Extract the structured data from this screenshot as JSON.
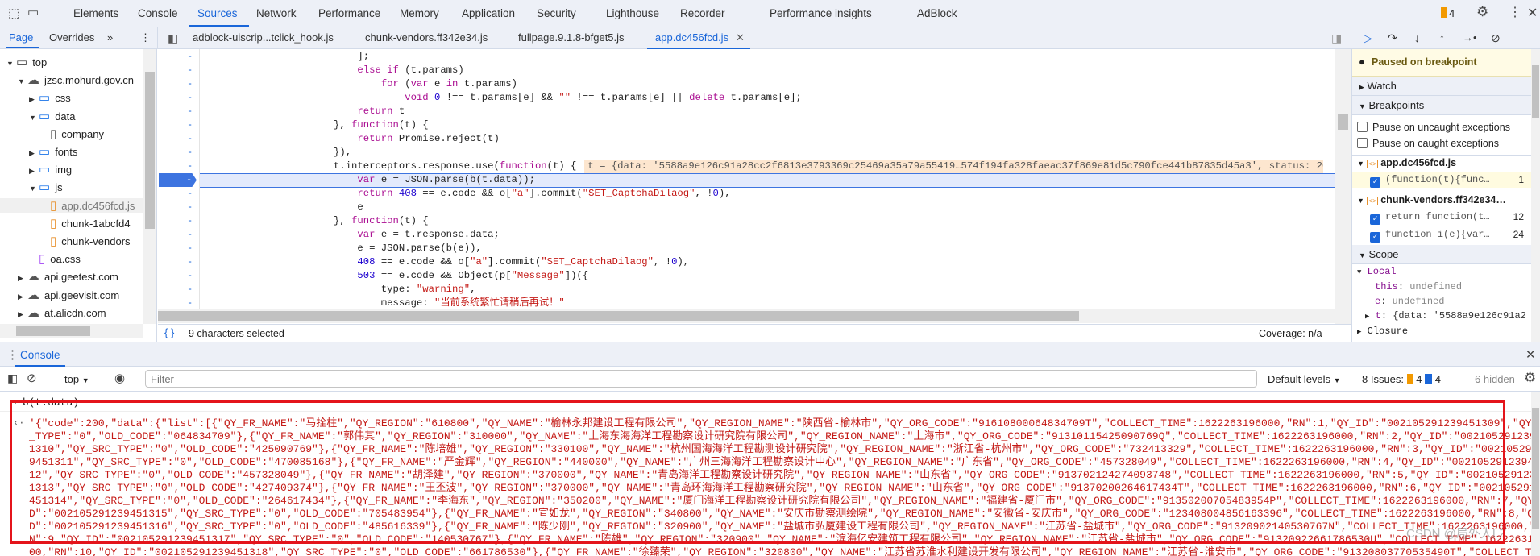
{
  "main_tabs": [
    {
      "label": "Elements"
    },
    {
      "label": "Console"
    },
    {
      "label": "Sources",
      "active": true
    },
    {
      "label": "Network"
    },
    {
      "label": "Performance"
    },
    {
      "label": "Memory"
    },
    {
      "label": "Application"
    },
    {
      "label": "Security"
    },
    {
      "label": "Lighthouse"
    },
    {
      "label": "Recorder"
    },
    {
      "label": "Performance insights"
    },
    {
      "label": "AdBlock"
    }
  ],
  "issues_badge": "4",
  "navigator_tabs": [
    "Page",
    "Overrides"
  ],
  "file_tabs": [
    "adblock-uiscrip...tclick_hook.js",
    "chunk-vendors.ff342e34.js",
    "fullpage.9.1.8-bfget5.js",
    "app.dc456fcd.js"
  ],
  "tree": [
    {
      "label": "top",
      "type": "frame",
      "depth": 0,
      "open": true
    },
    {
      "label": "jzsc.mohurd.gov.cn",
      "type": "domain",
      "depth": 1,
      "open": true
    },
    {
      "label": "css",
      "type": "folder",
      "depth": 2,
      "open": false
    },
    {
      "label": "data",
      "type": "folder",
      "depth": 2,
      "open": true
    },
    {
      "label": "company",
      "type": "file",
      "depth": 3
    },
    {
      "label": "fonts",
      "type": "folder",
      "depth": 2,
      "open": false
    },
    {
      "label": "img",
      "type": "folder",
      "depth": 2,
      "open": false
    },
    {
      "label": "js",
      "type": "folder",
      "depth": 2,
      "open": true
    },
    {
      "label": "app.dc456fcd.js",
      "type": "js",
      "depth": 3,
      "selected": true
    },
    {
      "label": "chunk-1abcfd4",
      "type": "js",
      "depth": 3
    },
    {
      "label": "chunk-vendors",
      "type": "js",
      "depth": 3
    },
    {
      "label": "oa.css",
      "type": "css",
      "depth": 2
    },
    {
      "label": "api.geetest.com",
      "type": "domain",
      "depth": 1,
      "open": false
    },
    {
      "label": "api.geevisit.com",
      "type": "domain",
      "depth": 1,
      "open": false
    },
    {
      "label": "at.alicdn.com",
      "type": "domain",
      "depth": 1,
      "open": false
    }
  ],
  "code": {
    "gutter_mark": "-",
    "exec_line_index": 10,
    "inline_value_line_index": 9,
    "inline_value": "t = {data: '5588a9e126c91a28cc2f6813e3793369c25469a35a79a55419…574f194fa328faeac37f869e81d5c790fce441b87835d45a3', status: 20",
    "lines": [
      "    ]",
      "    ];",
      "    else if (t.params)",
      "        for (var e in t.params)",
      "            void 0 !== t.params[e] && \"\" !== t.params[e] || delete t.params[e];",
      "    return t",
      "}, function(t) {",
      "    return Promise.reject(t)",
      "}),",
      "t.interceptors.response.use(function(t) {",
      "    var e = JSON.parse(b(t.data));",
      "    return 408 == e.code && o[\"a\"].commit(\"SET_CaptchaDilaog\", !0),",
      "    e",
      "}, function(t) {",
      "    var e = t.response.data;",
      "    e = JSON.parse(b(e)),",
      "    408 == e.code && o[\"a\"].commit(\"SET_CaptchaDilaog\", !0),",
      "    503 == e.code && Object(p[\"Message\"])({",
      "        type: \"warning\",",
      "        message: \"当前系统繁忙请稍后再试！\""
    ]
  },
  "status_bar": {
    "selection": "9 characters selected",
    "coverage": "Coverage: n/a"
  },
  "debugger": {
    "paused": "Paused on breakpoint",
    "watch": "Watch",
    "breakpoints": "Breakpoints",
    "pause_uncaught": "Pause on uncaught exceptions",
    "pause_caught": "Pause on caught exceptions",
    "bp_files": [
      {
        "file": "app.dc456fcd.js",
        "items": [
          {
            "code": "(function(t){func…",
            "line": "1",
            "active": true
          }
        ]
      },
      {
        "file": "chunk-vendors.ff342e34…",
        "items": [
          {
            "code": "return function(t…",
            "line": "12"
          },
          {
            "code": "function i(e){var…",
            "line": "24"
          }
        ]
      }
    ],
    "scope": "Scope",
    "local": "Local",
    "vars": [
      {
        "name": "this",
        "value": "undefined"
      },
      {
        "name": "e",
        "value": "undefined"
      },
      {
        "name": "t",
        "value": "{data: '5588a9e126c91a2"
      }
    ],
    "closure": "Closure"
  },
  "drawer": {
    "tab": "Console"
  },
  "console_toolbar": {
    "context": "top",
    "filter_placeholder": "Filter",
    "levels": "Default levels",
    "issues_label": "8 Issues:",
    "warn_count": "4",
    "info_count": "4",
    "hidden": "6 hidden"
  },
  "console": {
    "input": "b(t.data)",
    "output_lines": [
      "'{\"code\":200,\"data\":{\"list\":[{\"QY_FR_NAME\":\"马拴柱\",\"QY_REGION\":\"610800\",\"QY_NAME\":\"榆林永邦建设工程有限公司\",\"QY_REGION_NAME\":\"陕西省-榆林市\",\"QY_ORG_CODE\":\"91610800064834709T\",\"COLLECT_TIME\":1622263196000,\"RN\":1,\"QY_ID\":\"002105291239451309\",\"QY_SRC",
      "_TYPE\":\"0\",\"OLD_CODE\":\"064834709\"},{\"QY_FR_NAME\":\"郭伟其\",\"QY_REGION\":\"310000\",\"QY_NAME\":\"上海东海海洋工程勘察设计研究院有限公司\",\"QY_REGION_NAME\":\"上海市\",\"QY_ORG_CODE\":\"91310115425090769Q\",\"COLLECT_TIME\":1622263196000,\"RN\":2,\"QY_ID\":\"00210529123945",
      "1310\",\"QY_SRC_TYPE\":\"0\",\"OLD_CODE\":\"425090769\"},{\"QY_FR_NAME\":\"陈培雄\",\"QY_REGION\":\"330100\",\"QY_NAME\":\"杭州国海海洋工程勘测设计研究院\",\"QY_REGION_NAME\":\"浙江省-杭州市\",\"QY_ORG_CODE\":\"732413329\",\"COLLECT_TIME\":1622263196000,\"RN\":3,\"QY_ID\":\"00210529123",
      "9451311\",\"QY_SRC_TYPE\":\"0\",\"OLD_CODE\":\"470085168\"},{\"QY_FR_NAME\":\"严金辉\",\"QY_REGION\":\"440000\",\"QY_NAME\":\"广州三海海洋工程勘察设计中心\",\"QY_REGION_NAME\":\"广东省\",\"QY_ORG_CODE\":\"457328049\",\"COLLECT_TIME\":1622263196000,\"RN\":4,\"QY_ID\":\"0021052912394513",
      "12\",\"QY_SRC_TYPE\":\"0\",\"OLD_CODE\":\"457328049\"},{\"QY_FR_NAME\":\"胡泽建\",\"QY_REGION\":\"370000\",\"QY_NAME\":\"青岛海洋工程勘察设计研究院\",\"QY_REGION_NAME\":\"山东省\",\"QY_ORG_CODE\":\"913702124274093748\",\"COLLECT_TIME\":1622263196000,\"RN\":5,\"QY_ID\":\"00210529123945",
      "1313\",\"QY_SRC_TYPE\":\"0\",\"OLD_CODE\":\"427409374\"},{\"QY_FR_NAME\":\"王丕波\",\"QY_REGION\":\"370000\",\"QY_NAME\":\"青岛环海海洋工程勘察研究院\",\"QY_REGION_NAME\":\"山东省\",\"QY_ORG_CODE\":\"91370200264617434T\",\"COLLECT_TIME\":1622263196000,\"RN\":6,\"QY_ID\":\"002105291239",
      "451314\",\"QY_SRC_TYPE\":\"0\",\"OLD_CODE\":\"264617434\"},{\"QY_FR_NAME\":\"李海东\",\"QY_REGION\":\"350200\",\"QY_NAME\":\"厦门海洋工程勘察设计研究院有限公司\",\"QY_REGION_NAME\":\"福建省-厦门市\",\"QY_ORG_CODE\":\"91350200705483954P\",\"COLLECT_TIME\":1622263196000,\"RN\":7,\"QY_I",
      "D\":\"002105291239451315\",\"QY_SRC_TYPE\":\"0\",\"OLD_CODE\":\"705483954\"},{\"QY_FR_NAME\":\"宣如龙\",\"QY_REGION\":\"340800\",\"QY_NAME\":\"安庆市勘察测绘院\",\"QY_REGION_NAME\":\"安徽省-安庆市\",\"QY_ORG_CODE\":\"123408004856163396\",\"COLLECT_TIME\":1622263196000,\"RN\":8,\"QY_I",
      "D\":\"002105291239451316\",\"QY_SRC_TYPE\":\"0\",\"OLD_CODE\":\"485616339\"},{\"QY_FR_NAME\":\"陈少刚\",\"QY_REGION\":\"320900\",\"QY_NAME\":\"盐城市弘厦建设工程有限公司\",\"QY_REGION_NAME\":\"江苏省-盐城市\",\"QY_ORG_CODE\":\"91320902140530767N\",\"COLLECT_TIME\":1622263196000,\"R",
      "N\":9,\"QY_ID\":\"002105291239451317\",\"QY_SRC_TYPE\":\"0\",\"OLD_CODE\":\"140530767\"},{\"QY_FR_NAME\":\"陈雄\",\"QY_REGION\":\"320900\",\"QY_NAME\":\"滨海亿安建筑工程有限公司\",\"QY_REGION_NAME\":\"江苏省-盐城市\",\"QY_ORG_CODE\":\"91320922661786530U\",\"COLLECT_TIME\":16222631960",
      "00,\"RN\":10,\"QY_ID\":\"002105291239451318\",\"QY_SRC_TYPE\":\"0\",\"OLD_CODE\":\"661786530\"},{\"QY_FR_NAME\":\"徐臻荣\",\"QY_REGION\":\"320800\",\"QY_NAME\":\"江苏省苏淮水利建设开发有限公司\",\"QY_REGION_NAME\":\"江苏省-淮安市\",\"QY_ORG_CODE\":\"91320803770535490T\",\"COLLECT_TIM"
    ]
  },
  "watermark": "CSDN @局外人LZ",
  "colors": {
    "accent": "#1a66d9",
    "highlight_box": "#e4141b",
    "paused_banner": "#fffbe5",
    "inline_value_bg": "#fde6cf",
    "warning": "#f29900"
  }
}
